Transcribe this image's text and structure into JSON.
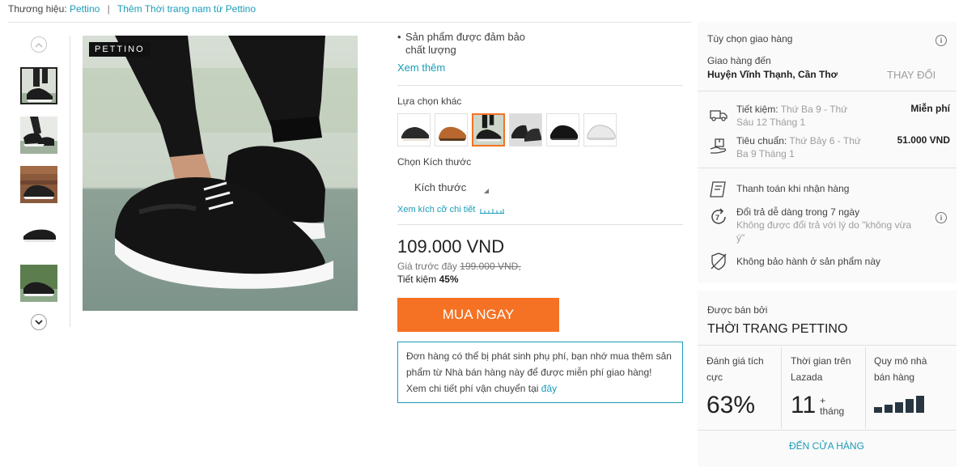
{
  "breadcrumb": {
    "brand_prefix": "Thương hiệu:",
    "brand_name": "Pettino",
    "separator": "|",
    "more_link": "Thêm Thời trang nam từ Pettino"
  },
  "gallery": {
    "brand_logo": "PETTINO",
    "thumb_count": 5,
    "selected_index": 0
  },
  "product": {
    "bullet": "Sản phẩm được đảm bảo chất lượng",
    "bullet_line1": "Sản phẩm được đảm bảo",
    "bullet_line2": "chất lượng",
    "see_more": "Xem thêm",
    "options_label": "Lựa chọn khác",
    "size_label": "Chọn Kích thước",
    "size_select": "Kích thước",
    "size_guide": "Xem kích cỡ chi tiết",
    "price": "109.000 VND",
    "old_price_label": "Giá trước đây",
    "old_price": "199.000 VND,",
    "saving_label": "Tiết kiệm",
    "saving_value": "45%",
    "buy_button": "MUA NGAY",
    "notice_line1": "Đơn hàng có thể bị phát sinh phụ phí, bạn nhớ mua thêm sản",
    "notice_line2": "phẩm từ Nhà bán hàng này để được miễn phí giao hàng!",
    "notice_line3": "Xem chi tiết phí vận chuyển tại",
    "notice_link": "đây"
  },
  "delivery": {
    "title": "Tùy chọn giao hàng",
    "deliver_to_label": "Giao hàng đến",
    "location": "Huyện Vĩnh Thạnh, Cần Thơ",
    "change": "THAY ĐỔI",
    "economy_label": "Tiết kiệm:",
    "economy_dates_1": "Thứ Ba 9 - Thứ",
    "economy_dates_2": "Sáu 12 Tháng 1",
    "economy_price": "Miễn phí",
    "standard_label": "Tiêu chuẩn:",
    "standard_dates_1": "Thứ Bảy 6 - Thứ",
    "standard_dates_2": "Ba 9 Tháng 1",
    "standard_price": "51.000 VND",
    "cod": "Thanh toán khi nhận hàng",
    "return_title": "Đổi trả dễ dàng trong 7 ngày",
    "return_note_1": "Không được đổi trả với lý do \"không vừa",
    "return_note_2": "ý\"",
    "warranty": "Không bảo hành ở sản phẩm này"
  },
  "seller": {
    "sold_by_label": "Được bán bởi",
    "name": "THỜI TRANG PETTINO",
    "rating_label_1": "Đánh giá tích",
    "rating_label_2": "cực",
    "rating_value": "63%",
    "time_label_1": "Thời gian trên",
    "time_label_2": "Lazada",
    "time_value": "11",
    "time_plus": "+",
    "time_unit": "tháng",
    "size_label_1": "Quy mô nhà",
    "size_label_2": "bán hàng",
    "size_level": 5,
    "store_link": "ĐẾN CỬA HÀNG"
  },
  "colors": {
    "accent": "#f57224",
    "link": "#1a9cb7",
    "panel_bg": "#fafafa"
  }
}
